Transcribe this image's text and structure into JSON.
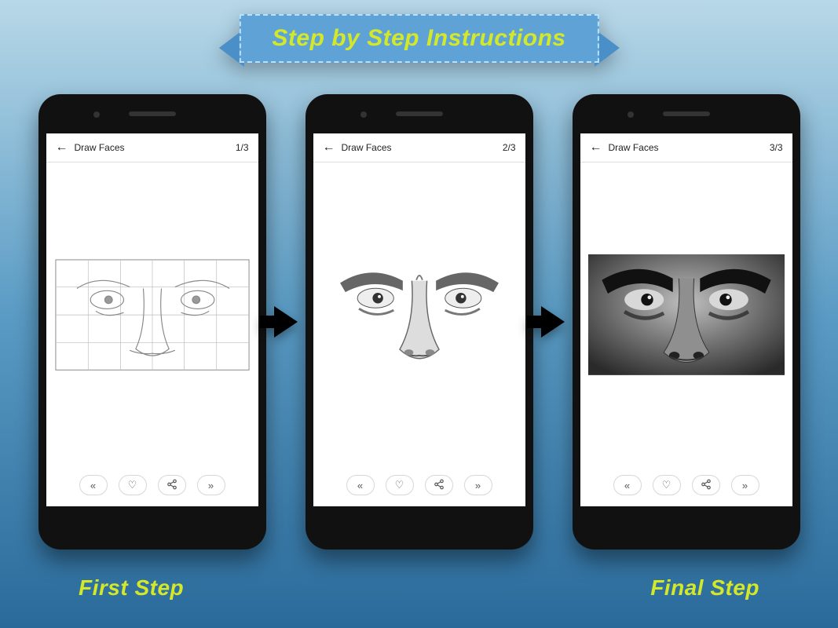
{
  "banner": {
    "title": "Step by Step Instructions"
  },
  "phones": [
    {
      "screen_title": "Draw Faces",
      "counter": "1/3"
    },
    {
      "screen_title": "Draw Faces",
      "counter": "2/3"
    },
    {
      "screen_title": "Draw Faces",
      "counter": "3/3"
    }
  ],
  "bottom_icons": {
    "prev": "«",
    "like": "♡",
    "share": "⠪",
    "next": "»"
  },
  "labels": {
    "first": "First Step",
    "final": "Final Step"
  }
}
